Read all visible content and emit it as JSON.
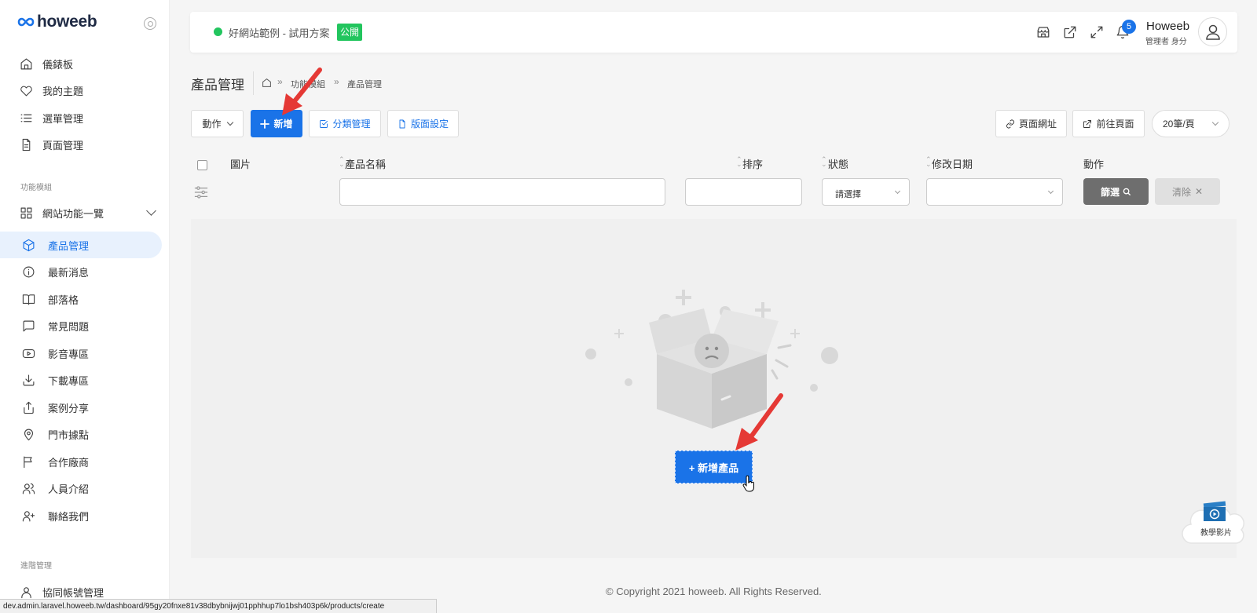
{
  "brand": {
    "logo_text": "howeeb"
  },
  "sidebar": {
    "top_items": [
      {
        "label": "儀錶板",
        "icon": "home-icon"
      },
      {
        "label": "我的主題",
        "icon": "heart-icon"
      },
      {
        "label": "選單管理",
        "icon": "list-icon"
      },
      {
        "label": "頁面管理",
        "icon": "file-text-icon"
      }
    ],
    "section_modules": "功能模組",
    "modules_group": {
      "label": "網站功能一覽",
      "icon": "grid-icon"
    },
    "modules": [
      {
        "label": "產品管理",
        "icon": "box-icon",
        "active": true
      },
      {
        "label": "最新消息",
        "icon": "info-icon"
      },
      {
        "label": "部落格",
        "icon": "book-icon"
      },
      {
        "label": "常見問題",
        "icon": "message-icon"
      },
      {
        "label": "影音專區",
        "icon": "youtube-icon"
      },
      {
        "label": "下載專區",
        "icon": "download-icon"
      },
      {
        "label": "案例分享",
        "icon": "share-icon"
      },
      {
        "label": "門市據點",
        "icon": "map-pin-icon"
      },
      {
        "label": "合作廠商",
        "icon": "flag-icon"
      },
      {
        "label": "人員介紹",
        "icon": "users-icon"
      },
      {
        "label": "聯絡我們",
        "icon": "user-plus-icon"
      }
    ],
    "section_advanced": "進階管理",
    "advanced_items": [
      {
        "label": "協同帳號管理",
        "icon": "user-icon"
      }
    ]
  },
  "topbar": {
    "site_name": "好網站範例 - 試用方案",
    "site_badge": "公開",
    "notification_count": "5",
    "user_name": "Howeeb",
    "user_role": "管理者 身分"
  },
  "page": {
    "title": "產品管理",
    "breadcrumb": [
      "功能模組",
      "產品管理"
    ]
  },
  "toolbar": {
    "action_label": "動作",
    "add_label": "新增",
    "category_label": "分類管理",
    "layout_label": "版面設定",
    "page_url_label": "頁面網址",
    "goto_page_label": "前往頁面",
    "per_page": "20筆/頁"
  },
  "table": {
    "headers": [
      "圖片",
      "產品名稱",
      "排序",
      "狀態",
      "修改日期",
      "動作"
    ],
    "status_placeholder": "請選擇",
    "filter_label": "篩選",
    "clear_label": "清除"
  },
  "empty": {
    "add_product_label": "+ 新增產品"
  },
  "tutorial_label": "教學影片",
  "footer": {
    "copyright": "© Copyright 2021 howeeb. All Rights Reserved."
  },
  "statusbar": {
    "url": "dev.admin.laravel.howeeb.tw/dashboard/95gy20fnxe81v38dbybnijwj01pphhup7lo1bsh403p6k/products/create"
  },
  "colors": {
    "primary": "#1a73e8",
    "success": "#22c55e",
    "arrow": "#e53935"
  }
}
